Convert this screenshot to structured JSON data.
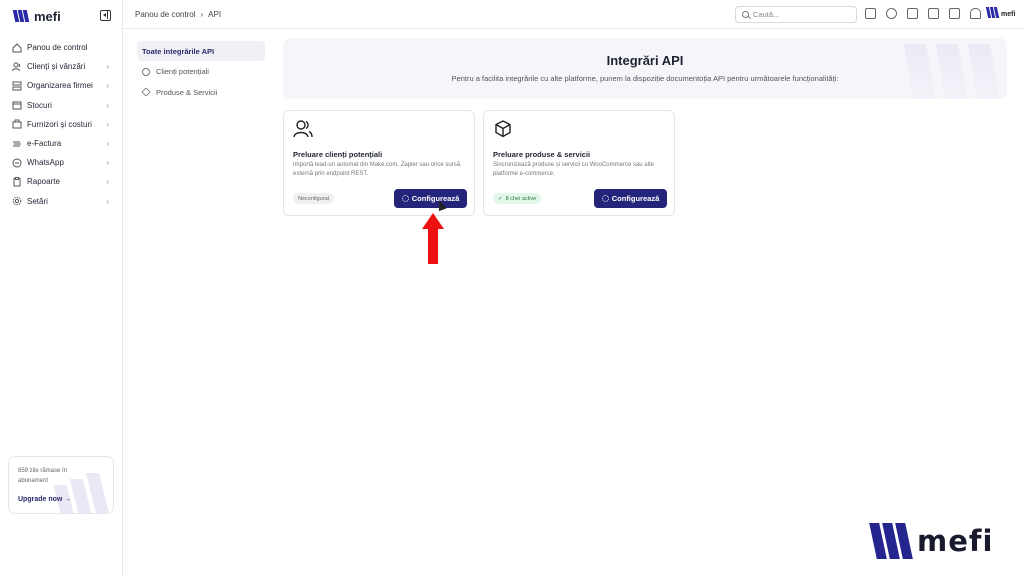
{
  "brand": {
    "name": "mefi"
  },
  "sidebar": {
    "items": [
      {
        "label": "Panou de control",
        "icon": "house-icon",
        "has_chevron": false
      },
      {
        "label": "Clienți și vânzări",
        "icon": "users-icon",
        "has_chevron": true
      },
      {
        "label": "Organizarea firmei",
        "icon": "org-icon",
        "has_chevron": true
      },
      {
        "label": "Stocuri",
        "icon": "box-icon",
        "has_chevron": true
      },
      {
        "label": "Furnizori și costuri",
        "icon": "building-icon",
        "has_chevron": true
      },
      {
        "label": "e-Factura",
        "icon": "efactura-icon",
        "has_chevron": true
      },
      {
        "label": "WhatsApp",
        "icon": "whatsapp-icon",
        "has_chevron": true
      },
      {
        "label": "Rapoarte",
        "icon": "report-icon",
        "has_chevron": true
      },
      {
        "label": "Setări",
        "icon": "gear-icon",
        "has_chevron": true
      }
    ],
    "upgrade": {
      "text": "859 zile rămase în abonament",
      "link": "Upgrade now"
    }
  },
  "header": {
    "breadcrumb": [
      "Panou de control",
      "API"
    ],
    "search_placeholder": "Caută...",
    "logo_text": "mefi"
  },
  "subnav": {
    "items": [
      {
        "label": "Toate integrările API",
        "active": true
      },
      {
        "label": "Clienți potențiali",
        "active": false
      },
      {
        "label": "Produse & Servicii",
        "active": false
      }
    ]
  },
  "hero": {
    "title": "Integrări API",
    "subtitle": "Pentru a facilita integrările cu alte platforme, punem la dispoziție documentoția API pentru următoarele funcționalități:"
  },
  "cards": [
    {
      "title": "Preluare clienți potențiali",
      "description": "Importă lead-uri automat din Make.com, Zapier sau orice sursă externă prin endpoint REST.",
      "badge": "Neconfigurat",
      "button": "Configurează"
    },
    {
      "title": "Preluare produse & servicii",
      "description": "Sincronizează produse și servicii cu WooCommerce sau alte platforme e-commerce.",
      "badge": "8 chei active",
      "button": "Configurează"
    }
  ],
  "watermark": {
    "text": "mefi"
  },
  "colors": {
    "primary": "#24247a",
    "brand": "#2a2aa8",
    "annotation": "#ee1111",
    "success_bg": "#e3f6ea"
  }
}
